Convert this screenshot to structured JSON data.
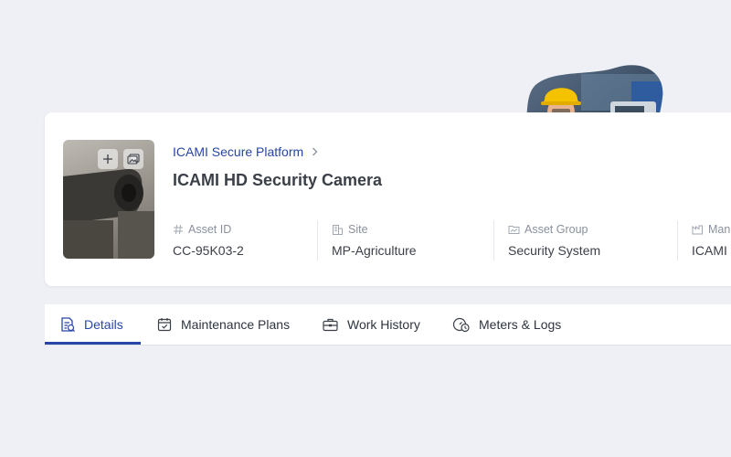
{
  "breadcrumb": {
    "label": "ICAMI Secure Platform"
  },
  "asset": {
    "title": "ICAMI HD Security Camera",
    "fields": [
      {
        "label": "Asset ID",
        "value": "CC-95K03-2"
      },
      {
        "label": "Site",
        "value": "MP-Agriculture"
      },
      {
        "label": "Asset Group",
        "value": "Security System"
      },
      {
        "label": "Man",
        "value": "ICAMI"
      }
    ]
  },
  "tabs": [
    {
      "label": "Details"
    },
    {
      "label": "Maintenance Plans"
    },
    {
      "label": "Work History"
    },
    {
      "label": "Meters & Logs"
    }
  ],
  "colors": {
    "accent": "#2746a8",
    "page_bg": "#eef0f5",
    "card_bg": "#ffffff"
  },
  "icons": {
    "thumb_add": "plus-icon",
    "thumb_gallery": "image-gallery-icon",
    "asset_id": "hash-icon",
    "site": "building-icon",
    "asset_group": "folder-chart-icon",
    "manufacturer": "factory-icon"
  }
}
